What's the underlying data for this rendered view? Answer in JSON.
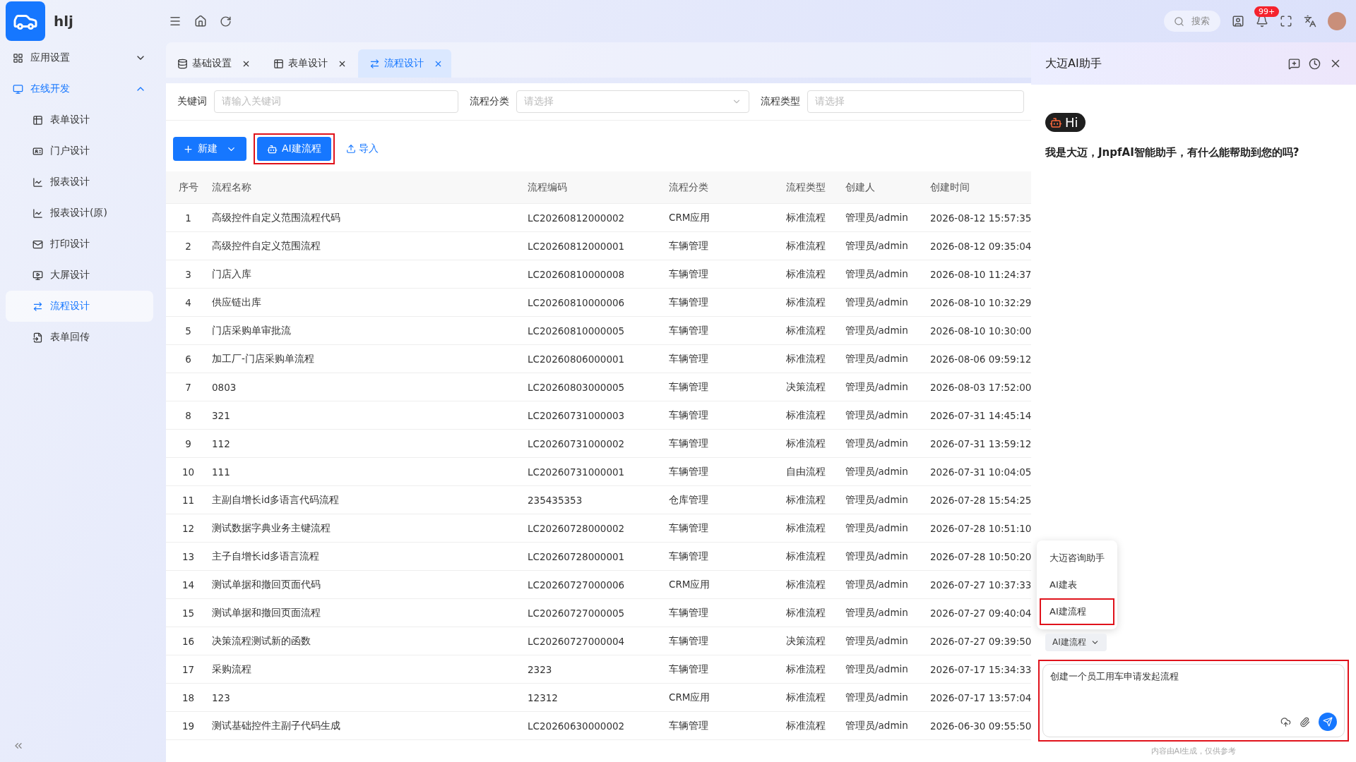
{
  "app": {
    "name": "hlj"
  },
  "sidebar": {
    "items": [
      {
        "label": "应用设置",
        "expanded": false,
        "selected": false
      },
      {
        "label": "在线开发",
        "expanded": true,
        "selected": true,
        "children": [
          {
            "label": "表单设计",
            "selected": false
          },
          {
            "label": "门户设计",
            "selected": false
          },
          {
            "label": "报表设计",
            "selected": false
          },
          {
            "label": "报表设计(原)",
            "selected": false
          },
          {
            "label": "打印设计",
            "selected": false
          },
          {
            "label": "大屏设计",
            "selected": false
          },
          {
            "label": "流程设计",
            "selected": true
          },
          {
            "label": "表单回传",
            "selected": false
          }
        ]
      }
    ]
  },
  "header": {
    "search_placeholder": "搜索",
    "badge": "99+"
  },
  "tabs": [
    {
      "label": "基础设置",
      "selected": false
    },
    {
      "label": "表单设计",
      "selected": false
    },
    {
      "label": "流程设计",
      "selected": true
    }
  ],
  "filters": [
    {
      "label": "关键词",
      "placeholder": "请输入关键词",
      "kind": "input"
    },
    {
      "label": "流程分类",
      "placeholder": "请选择",
      "kind": "select"
    },
    {
      "label": "流程类型",
      "placeholder": "请选择",
      "kind": "input"
    }
  ],
  "toolbar": {
    "new": "新建",
    "ai": "AI建流程",
    "ai_highlighted": true,
    "import": "导入"
  },
  "table": {
    "columns": [
      "序号",
      "流程名称",
      "流程编码",
      "流程分类",
      "流程类型",
      "创建人",
      "创建时间"
    ],
    "rows": [
      [
        "1",
        "高级控件自定义范围流程代码",
        "LC20260812000002",
        "CRM应用",
        "标准流程",
        "管理员/admin",
        "2026-08-12 15:57:35"
      ],
      [
        "2",
        "高级控件自定义范围流程",
        "LC20260812000001",
        "车辆管理",
        "标准流程",
        "管理员/admin",
        "2026-08-12 09:35:04"
      ],
      [
        "3",
        "门店入库",
        "LC20260810000008",
        "车辆管理",
        "标准流程",
        "管理员/admin",
        "2026-08-10 11:24:37"
      ],
      [
        "4",
        "供应链出库",
        "LC20260810000006",
        "车辆管理",
        "标准流程",
        "管理员/admin",
        "2026-08-10 10:32:29"
      ],
      [
        "5",
        "门店采购单审批流",
        "LC20260810000005",
        "车辆管理",
        "标准流程",
        "管理员/admin",
        "2026-08-10 10:30:00"
      ],
      [
        "6",
        "加工厂-门店采购单流程",
        "LC20260806000001",
        "车辆管理",
        "标准流程",
        "管理员/admin",
        "2026-08-06 09:59:12"
      ],
      [
        "7",
        "0803",
        "LC20260803000005",
        "车辆管理",
        "决策流程",
        "管理员/admin",
        "2026-08-03 17:52:00"
      ],
      [
        "8",
        "321",
        "LC20260731000003",
        "车辆管理",
        "标准流程",
        "管理员/admin",
        "2026-07-31 14:45:14"
      ],
      [
        "9",
        "112",
        "LC20260731000002",
        "车辆管理",
        "标准流程",
        "管理员/admin",
        "2026-07-31 13:59:12"
      ],
      [
        "10",
        "111",
        "LC20260731000001",
        "车辆管理",
        "自由流程",
        "管理员/admin",
        "2026-07-31 10:04:05"
      ],
      [
        "11",
        "主副自增长id多语言代码流程",
        "235435353",
        "仓库管理",
        "标准流程",
        "管理员/admin",
        "2026-07-28 15:54:25"
      ],
      [
        "12",
        "测试数据字典业务主键流程",
        "LC20260728000002",
        "车辆管理",
        "标准流程",
        "管理员/admin",
        "2026-07-28 10:51:10"
      ],
      [
        "13",
        "主子自增长id多语言流程",
        "LC20260728000001",
        "车辆管理",
        "标准流程",
        "管理员/admin",
        "2026-07-28 10:50:20"
      ],
      [
        "14",
        "测试单据和撤回页面代码",
        "LC20260727000006",
        "CRM应用",
        "标准流程",
        "管理员/admin",
        "2026-07-27 10:37:33"
      ],
      [
        "15",
        "测试单据和撤回页面流程",
        "LC20260727000005",
        "车辆管理",
        "标准流程",
        "管理员/admin",
        "2026-07-27 09:40:04"
      ],
      [
        "16",
        "决策流程测试新的函数",
        "LC20260727000004",
        "车辆管理",
        "决策流程",
        "管理员/admin",
        "2026-07-27 09:39:50"
      ],
      [
        "17",
        "采购流程",
        "2323",
        "车辆管理",
        "标准流程",
        "管理员/admin",
        "2026-07-17 15:34:33"
      ],
      [
        "18",
        "123",
        "12312",
        "CRM应用",
        "标准流程",
        "管理员/admin",
        "2026-07-17 13:57:04"
      ],
      [
        "19",
        "测试基础控件主副子代码生成",
        "LC20260630000002",
        "车辆管理",
        "标准流程",
        "管理员/admin",
        "2026-06-30 09:55:50"
      ]
    ]
  },
  "assistant": {
    "title": "大迈AI助手",
    "hi": "Hi",
    "greeting": "我是大迈，JnpfAI智能助手，有什么能帮助到您的吗?",
    "menu": [
      {
        "label": "大迈咨询助手",
        "highlighted": false
      },
      {
        "label": "AI建表",
        "highlighted": false
      },
      {
        "label": "AI建流程",
        "highlighted": true
      }
    ],
    "mode": "AI建流程",
    "input": "创建一个员工用车申请发起流程",
    "input_highlighted": true,
    "footer": "内容由AI生成，仅供参考"
  }
}
